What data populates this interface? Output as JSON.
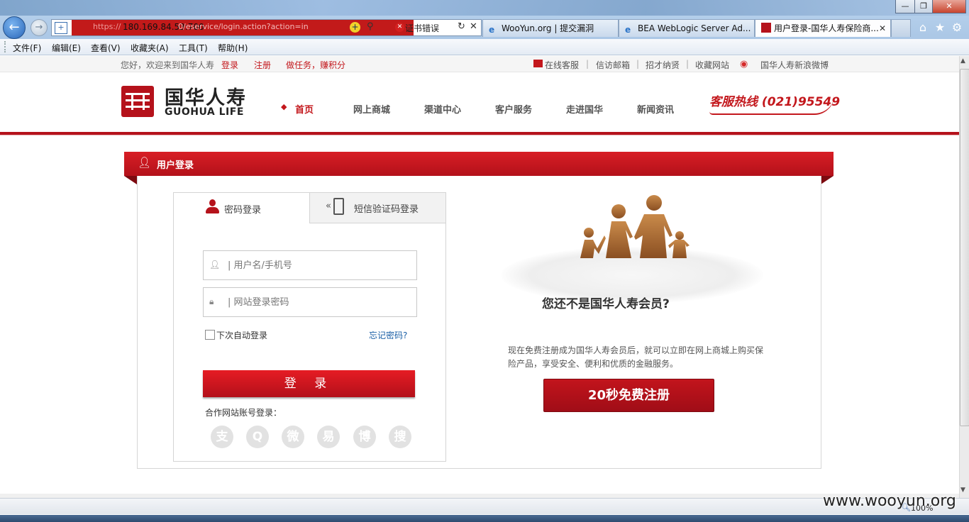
{
  "browser": {
    "address": {
      "scheme_dim": "https://",
      "host": "180.169.84.53:700",
      "path_dim": "0/eservice/login.action?action=in",
      "cert_error": "证书错误"
    },
    "tabs": [
      {
        "label": "WooYun.org | 提交漏洞"
      },
      {
        "label": "BEA WebLogic Server Ad..."
      },
      {
        "label": "用户登录-国华人寿保险商..."
      }
    ],
    "menu": [
      "文件(F)",
      "编辑(E)",
      "查看(V)",
      "收藏夹(A)",
      "工具(T)",
      "帮助(H)"
    ],
    "zoom": "100%"
  },
  "topbar": {
    "welcome": "您好，欢迎来到国华人寿",
    "login": "登录",
    "register": "注册",
    "tasks": "做任务，赚积分",
    "online_service": "在线客服",
    "mailbox": "信访邮箱",
    "recruit": "招才纳贤",
    "favorite": "收藏网站",
    "weibo": "国华人寿新浪微博",
    "sep": "|"
  },
  "header": {
    "logo_cn": "国华人寿",
    "logo_en": "GUOHUA LIFE",
    "nav": [
      "首页",
      "网上商城",
      "渠道中心",
      "客户服务",
      "走进国华",
      "新闻资讯"
    ],
    "hotline_label": "客服热线",
    "hotline_number": "(021)95549"
  },
  "login": {
    "panel_title": "用户登录",
    "tab_password": "密码登录",
    "tab_sms": "短信验证码登录",
    "username_placeholder": "| 用户名/手机号",
    "password_placeholder": "| 网站登录密码",
    "remember": "下次自动登录",
    "forgot": "忘记密码?",
    "submit": "登 录",
    "partner_label": "合作网站账号登录：",
    "partners": [
      "支",
      "Q",
      "微",
      "易",
      "博",
      "搜"
    ]
  },
  "member": {
    "title": "您还不是国华人寿会员?",
    "desc": "现在免费注册成为国华人寿会员后，就可以立即在网上商城上购买保险产品，享受安全、便利和优质的金融服务。",
    "register_button": "20秒免费注册"
  },
  "watermark": "www.wooyun.org",
  "colors": {
    "brand_red": "#b5121b",
    "browser_blue": "#a5c2e2"
  }
}
